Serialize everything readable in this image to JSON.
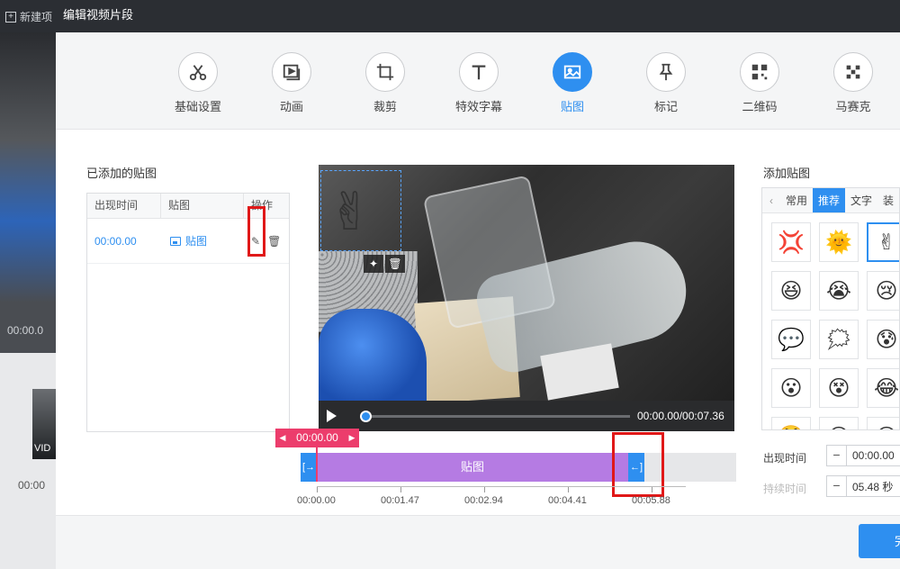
{
  "background_app": {
    "new_project_label": "新建项",
    "time_label": "00:00.0",
    "thumb_label": "VID",
    "bottom_time": "00:00"
  },
  "dialog": {
    "title": "编辑视频片段"
  },
  "tabs": [
    {
      "label": "基础设置",
      "icon": "scissors-icon"
    },
    {
      "label": "动画",
      "icon": "play-frame-icon"
    },
    {
      "label": "裁剪",
      "icon": "crop-icon"
    },
    {
      "label": "特效字幕",
      "icon": "text-t-icon"
    },
    {
      "label": "贴图",
      "icon": "image-icon",
      "active": true
    },
    {
      "label": "标记",
      "icon": "pin-icon"
    },
    {
      "label": "二维码",
      "icon": "qrcode-icon"
    },
    {
      "label": "马赛克",
      "icon": "mosaic-icon"
    }
  ],
  "added_stickers": {
    "title": "已添加的贴图",
    "columns": [
      "出现时间",
      "贴图",
      "操作"
    ],
    "rows": [
      {
        "time": "00:00.00",
        "sticker": "贴图"
      }
    ]
  },
  "player": {
    "time_readout": "00:00.00/00:07.36",
    "progress": 0.0
  },
  "timeline": {
    "current_time": "00:00.00",
    "segment_label": "贴图",
    "ticks": [
      "00:00.00",
      "00:01.47",
      "00:02.94",
      "00:04.41",
      "00:05.88"
    ]
  },
  "add_panel": {
    "title": "添加贴图",
    "tabs": [
      "常用",
      "推荐",
      "文字",
      "装"
    ],
    "active_tab": "推荐",
    "stickers": [
      "💢",
      "🌞",
      "✌",
      "😆",
      "😭",
      "😢",
      "💬",
      "🗯",
      "😰",
      "😮",
      "😵",
      "😂",
      "😤",
      "😊",
      "😅"
    ]
  },
  "form": {
    "appear_time_label": "出现时间",
    "appear_time_value": "00:00.00",
    "duration_label": "持续时间",
    "duration_value": "05.48 秒"
  },
  "confirm_label": "完成",
  "colors": {
    "accent": "#2e8ff0",
    "segment": "#b57be3",
    "cursor": "#ec3d6c",
    "highlight": "#e01818"
  }
}
